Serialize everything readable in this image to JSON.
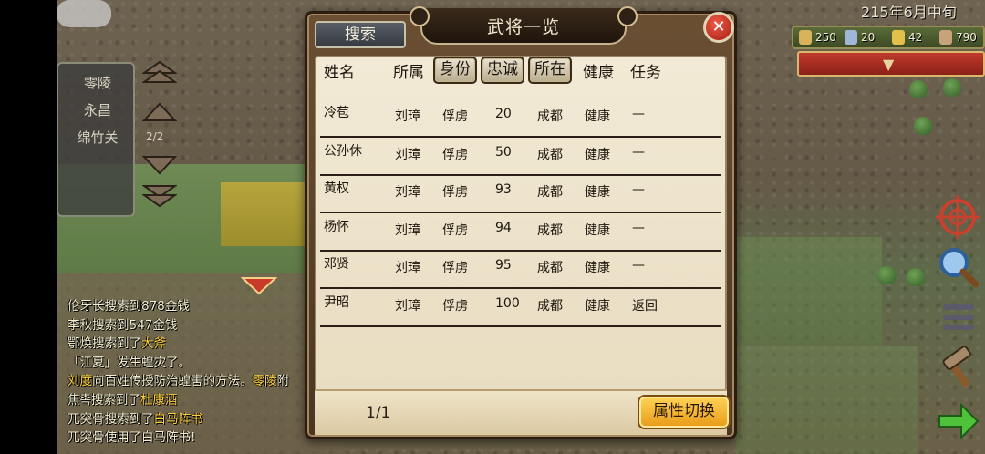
{
  "hud": {
    "date": "215年6月中旬",
    "resources": [
      {
        "icon": "food-icon",
        "value": "250",
        "color": "#d9b25c"
      },
      {
        "icon": "soldier-icon",
        "value": "20",
        "color": "#9fb6d8"
      },
      {
        "icon": "gold-icon",
        "value": "42",
        "color": "#e2c04a"
      },
      {
        "icon": "horse-icon",
        "value": "790",
        "color": "#c7a27a"
      }
    ]
  },
  "city_list": {
    "items": [
      "零陵",
      "永昌",
      "绵竹关"
    ],
    "page": "2/2"
  },
  "log": [
    [
      {
        "t": "伦牙长搜索到878金钱"
      }
    ],
    [
      {
        "t": "李秋搜索到547金钱"
      }
    ],
    [
      {
        "t": "鄂焕搜索到了"
      },
      {
        "t": "大斧",
        "hl": true
      }
    ],
    [
      {
        "t": "「江夏」发生蝗灾了。"
      }
    ],
    [
      {
        "t": "刘度",
        "hl": true
      },
      {
        "t": "向百姓传授防治蝗害的方法。"
      },
      {
        "t": "零陵",
        "hl": true
      },
      {
        "t": "附"
      }
    ],
    [
      {
        "t": "焦촉搜索到了"
      },
      {
        "t": "杜康酒",
        "hl": true
      }
    ],
    [
      {
        "t": "兀突骨搜索到了"
      },
      {
        "t": "白马阵书",
        "hl": true
      }
    ],
    [
      {
        "t": "兀突骨使用了白马阵书!"
      }
    ]
  ],
  "dialog": {
    "title": "武将一览",
    "search_label": "搜索",
    "close_label": "✕",
    "headers": {
      "name": "姓名",
      "faction": "所属",
      "status": "身份",
      "loyalty": "忠诚",
      "location": "所在",
      "health": "健康",
      "task": "任务"
    },
    "rows": [
      {
        "name": "冷苞",
        "faction": "刘璋",
        "status": "俘虏",
        "loyalty": "20",
        "location": "成都",
        "health": "健康",
        "task": "—"
      },
      {
        "name": "公孙休",
        "faction": "刘璋",
        "status": "俘虏",
        "loyalty": "50",
        "location": "成都",
        "health": "健康",
        "task": "—"
      },
      {
        "name": "黄权",
        "faction": "刘璋",
        "status": "俘虏",
        "loyalty": "93",
        "location": "成都",
        "health": "健康",
        "task": "—"
      },
      {
        "name": "杨怀",
        "faction": "刘璋",
        "status": "俘虏",
        "loyalty": "94",
        "location": "成都",
        "health": "健康",
        "task": "—"
      },
      {
        "name": "邓贤",
        "faction": "刘璋",
        "status": "俘虏",
        "loyalty": "95",
        "location": "成都",
        "health": "健康",
        "task": "—"
      },
      {
        "name": "尹昭",
        "faction": "刘璋",
        "status": "俘虏",
        "loyalty": "100",
        "location": "成都",
        "health": "健康",
        "task": "返回"
      }
    ],
    "page": "1/1",
    "switch_label": "属性切换"
  }
}
